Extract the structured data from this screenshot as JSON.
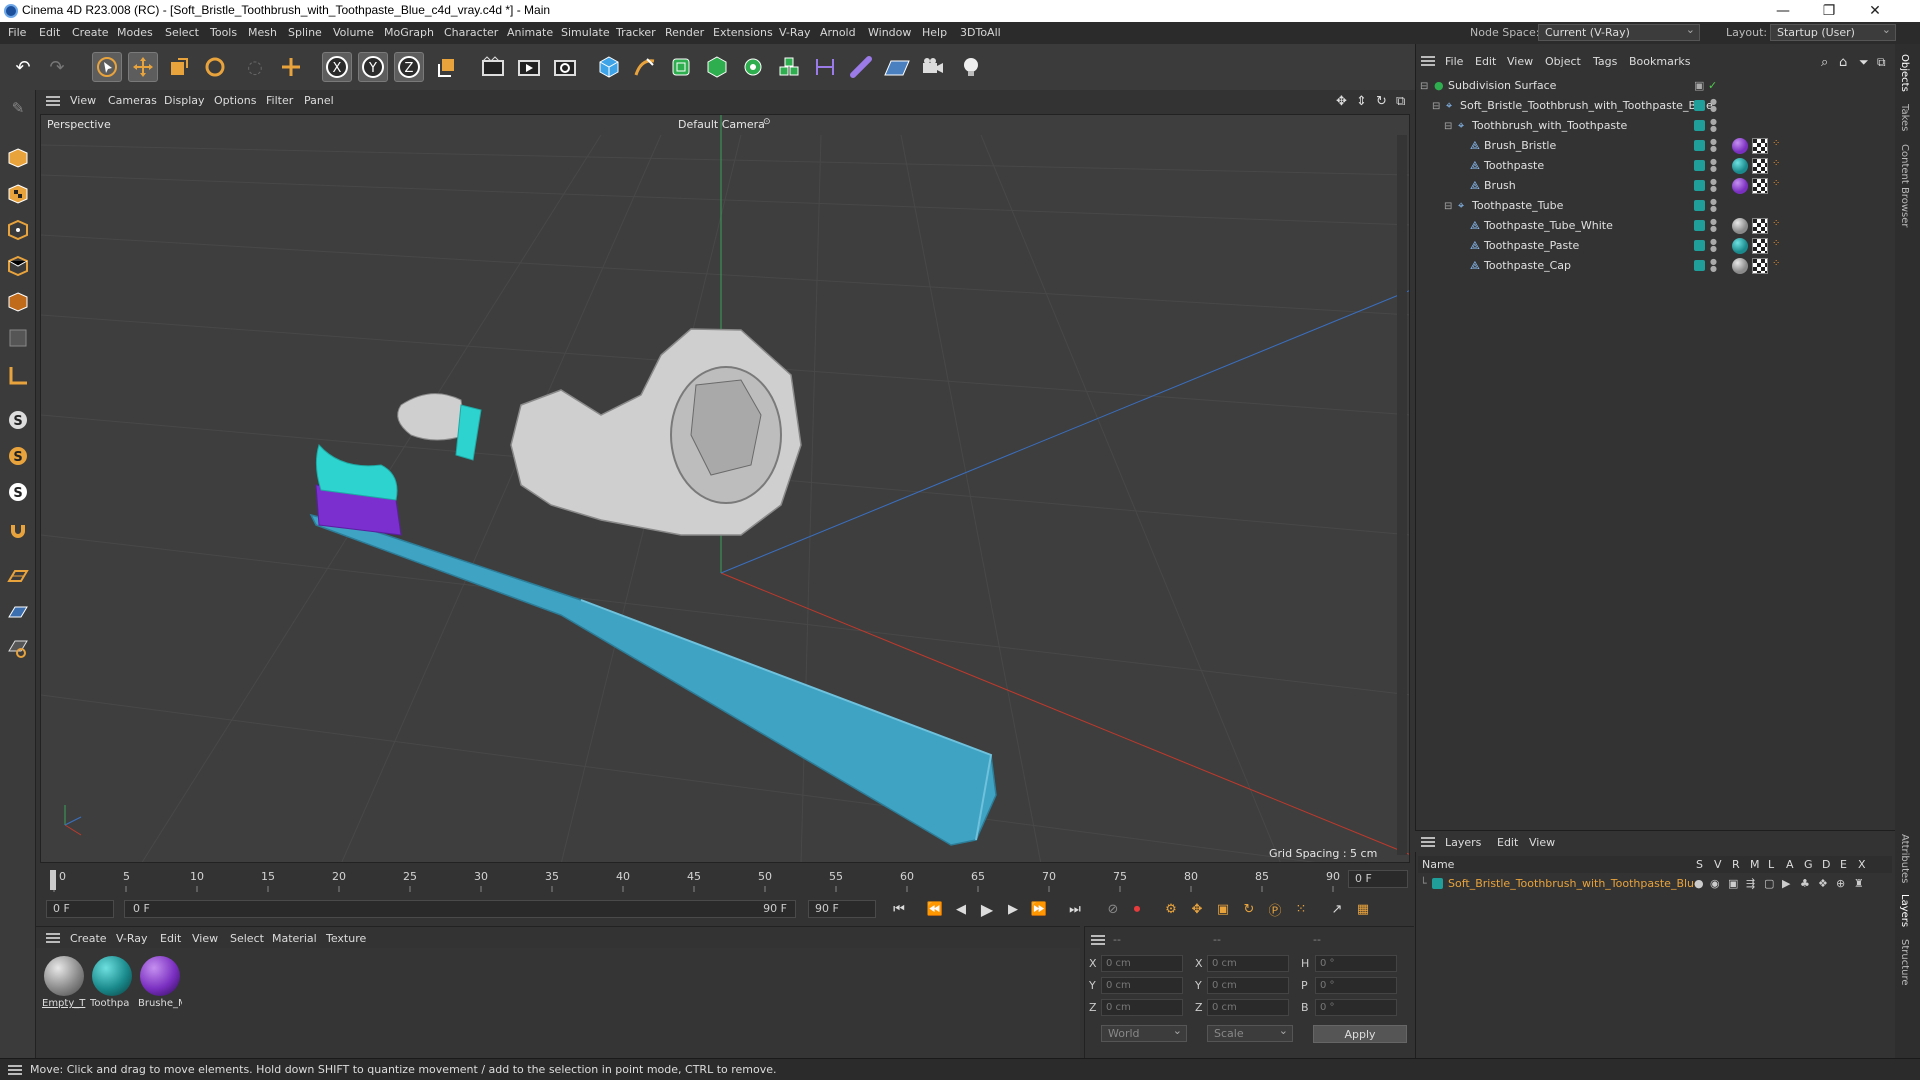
{
  "window": {
    "title": "Cinema 4D R23.008 (RC) - [Soft_Bristle_Toothbrush_with_Toothpaste_Blue_c4d_vray.c4d *] - Main",
    "minimize": "—",
    "maximize": "❐",
    "close": "✕"
  },
  "menubar": {
    "items": [
      "File",
      "Edit",
      "Create",
      "Modes",
      "Select",
      "Tools",
      "Mesh",
      "Spline",
      "Volume",
      "MoGraph",
      "Character",
      "Animate",
      "Simulate",
      "Tracker",
      "Render",
      "Extensions",
      "V-Ray",
      "Arnold",
      "Window",
      "Help",
      "3DToAll"
    ],
    "node_space_label": "Node Space:",
    "node_space_value": "Current (V-Ray)",
    "layout_label": "Layout:",
    "layout_value": "Startup (User)"
  },
  "viewport": {
    "menu": [
      "View",
      "Cameras",
      "Display",
      "Options",
      "Filter",
      "Panel"
    ],
    "view_name": "Perspective",
    "camera": "Default Camera",
    "camera_icon": "camera-icon",
    "grid_spacing": "Grid Spacing : 5 cm",
    "colors": {
      "background": "#3e3e3e",
      "grid": "#4a4a4a",
      "x_axis": "#c0392b",
      "y_axis": "#3aa05a",
      "z_axis": "#3a6fc0",
      "handle": "#3fa3c4",
      "bristle": "#7b2fcf",
      "paste": "#2dd4cf",
      "tube": "#cfcfcf"
    }
  },
  "timeline": {
    "ticks": [
      "0",
      "5",
      "10",
      "15",
      "20",
      "25",
      "30",
      "35",
      "40",
      "45",
      "50",
      "55",
      "60",
      "65",
      "70",
      "75",
      "80",
      "85",
      "90"
    ],
    "current_frame": "0 F",
    "start_field": "0 F",
    "range_start": "0 F",
    "range_end": "90 F",
    "end_field": "90 F"
  },
  "materials": {
    "menu": [
      "Create",
      "V-Ray",
      "Edit",
      "View",
      "Select",
      "Material",
      "Texture"
    ],
    "items": [
      {
        "name": "Empty_T",
        "color": "#9a9a9a"
      },
      {
        "name": "Toothpa",
        "color": "#1a8a8c"
      },
      {
        "name": "Brushe_M",
        "color": "#7a2fc0"
      }
    ]
  },
  "coordinates": {
    "header": [
      "--",
      "--",
      "--"
    ],
    "rows": [
      {
        "a": "X",
        "a_val": "0 cm",
        "b": "X",
        "b_val": "0 cm",
        "c": "H",
        "c_val": "0 °"
      },
      {
        "a": "Y",
        "a_val": "0 cm",
        "b": "Y",
        "b_val": "0 cm",
        "c": "P",
        "c_val": "0 °"
      },
      {
        "a": "Z",
        "a_val": "0 cm",
        "b": "Z",
        "b_val": "0 cm",
        "c": "B",
        "c_val": "0 °"
      }
    ],
    "mode1": "World",
    "mode2": "Scale",
    "apply": "Apply"
  },
  "object_manager": {
    "menu": [
      "File",
      "Edit",
      "View",
      "Object",
      "Tags",
      "Bookmarks"
    ],
    "objects": [
      {
        "name": "Subdivision Surface",
        "depth": 0,
        "icon": "subdivision-icon",
        "tag": null
      },
      {
        "name": "Soft_Bristle_Toothbrush_with_Toothpaste_Blue",
        "depth": 1,
        "icon": "null-object-icon",
        "tag": null
      },
      {
        "name": "Toothbrush_with_Toothpaste",
        "depth": 2,
        "icon": "null-object-icon",
        "tag": null
      },
      {
        "name": "Brush_Bristle",
        "depth": 3,
        "icon": "polygon-object-icon",
        "tag": "#7a2fc0"
      },
      {
        "name": "Toothpaste",
        "depth": 3,
        "icon": "polygon-object-icon",
        "tag": "#1a8a8c"
      },
      {
        "name": "Brush",
        "depth": 3,
        "icon": "polygon-object-icon",
        "tag": "#7a2fc0"
      },
      {
        "name": "Toothpaste_Tube",
        "depth": 2,
        "icon": "null-object-icon",
        "tag": null
      },
      {
        "name": "Toothpaste_Tube_White",
        "depth": 3,
        "icon": "polygon-object-icon",
        "tag": "#9a9a9a"
      },
      {
        "name": "Toothpaste_Paste",
        "depth": 3,
        "icon": "polygon-object-icon",
        "tag": "#1a8a8c"
      },
      {
        "name": "Toothpaste_Cap",
        "depth": 3,
        "icon": "polygon-object-icon",
        "tag": "#9a9a9a"
      }
    ]
  },
  "layers": {
    "menu": [
      "Layers",
      "Edit",
      "View"
    ],
    "col_name": "Name",
    "flags": [
      "S",
      "V",
      "R",
      "M",
      "L",
      "A",
      "G",
      "D",
      "E",
      "X"
    ],
    "layer_name": "Soft_Bristle_Toothbrush_with_Toothpaste_Blue",
    "layer_color": "#1f9e9a"
  },
  "side_tabs": [
    "Objects",
    "Takes",
    "Content Browser",
    "Attributes",
    "Layers",
    "Structure"
  ],
  "status": "Move: Click and drag to move elements. Hold down SHIFT to quantize movement / add to the selection in point mode, CTRL to remove."
}
